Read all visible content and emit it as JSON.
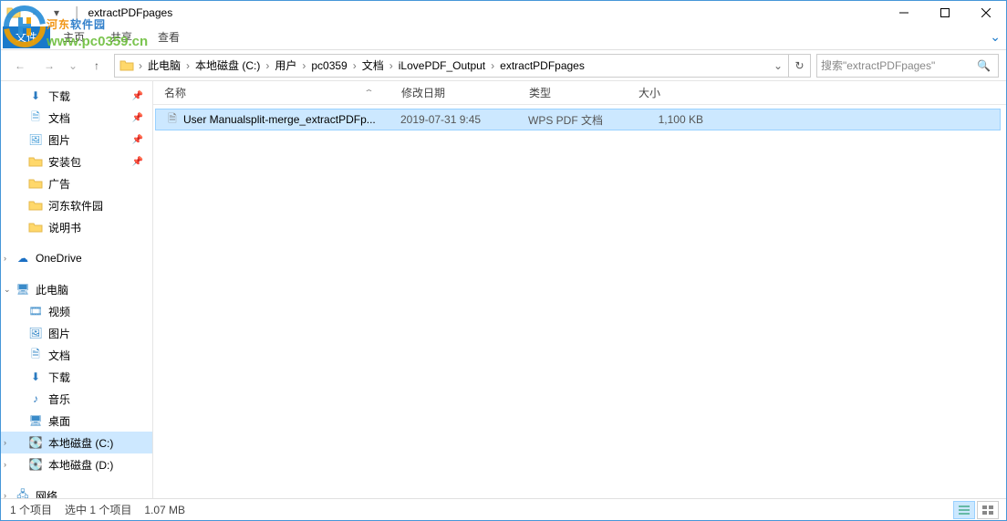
{
  "window": {
    "title": "extractPDFpages"
  },
  "ribbon": {
    "file": "文件",
    "home": "主页",
    "share": "共享",
    "view": "查看"
  },
  "breadcrumbs": [
    "此电脑",
    "本地磁盘 (C:)",
    "用户",
    "pc0359",
    "文档",
    "iLovePDF_Output",
    "extractPDFpages"
  ],
  "search": {
    "placeholder": "搜索\"extractPDFpages\""
  },
  "columns": {
    "name": "名称",
    "date": "修改日期",
    "type": "类型",
    "size": "大小"
  },
  "files": [
    {
      "name": "User Manualsplit-merge_extractPDFp...",
      "date": "2019-07-31 9:45",
      "type": "WPS PDF 文档",
      "size": "1,100 KB"
    }
  ],
  "sidebar": {
    "downloads": "下载",
    "documents": "文档",
    "pictures": "图片",
    "installpkg": "安装包",
    "ads": "广告",
    "hedong": "河东软件园",
    "manual": "说明书",
    "onedrive": "OneDrive",
    "thispc": "此电脑",
    "videos": "视频",
    "pictures2": "图片",
    "documents2": "文档",
    "downloads2": "下载",
    "music": "音乐",
    "desktop": "桌面",
    "cdrive": "本地磁盘 (C:)",
    "ddrive": "本地磁盘 (D:)",
    "network": "网络"
  },
  "status": {
    "count": "1 个项目",
    "selected": "选中 1 个项目",
    "size": "1.07 MB"
  },
  "watermark": {
    "brand_cn": "河东",
    "brand_cn2": "软件园",
    "url": "www.pc0359.cn"
  }
}
